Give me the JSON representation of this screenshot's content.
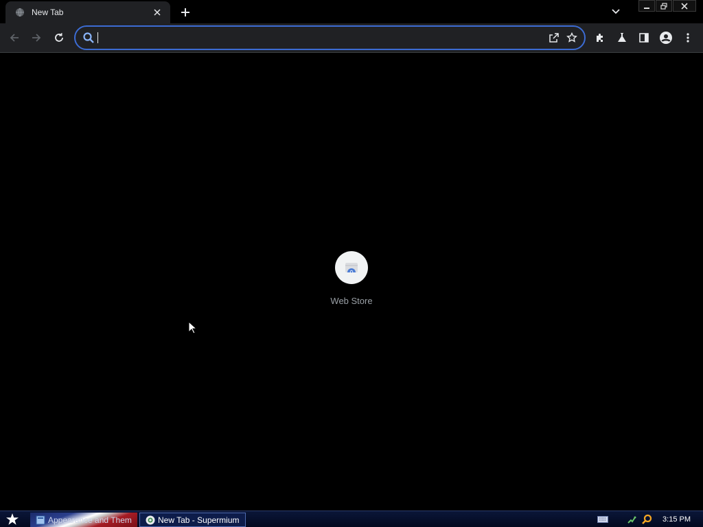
{
  "browser": {
    "tab": {
      "title": "New Tab",
      "favicon": "globe-icon"
    },
    "omnibox": {
      "value": "",
      "placeholder": ""
    }
  },
  "content": {
    "shortcuts": [
      {
        "label": "Web Store",
        "icon": "web-store-icon"
      }
    ]
  },
  "taskbar": {
    "buttons": [
      {
        "label": "Appearance and Them",
        "icon": "control-panel-icon"
      },
      {
        "label": "New Tab - Supermium",
        "icon": "supermium-icon"
      }
    ],
    "clock": "3:15 PM"
  },
  "colors": {
    "accent": "#3c6cd4",
    "toolbar": "#202124",
    "background": "#000000"
  }
}
